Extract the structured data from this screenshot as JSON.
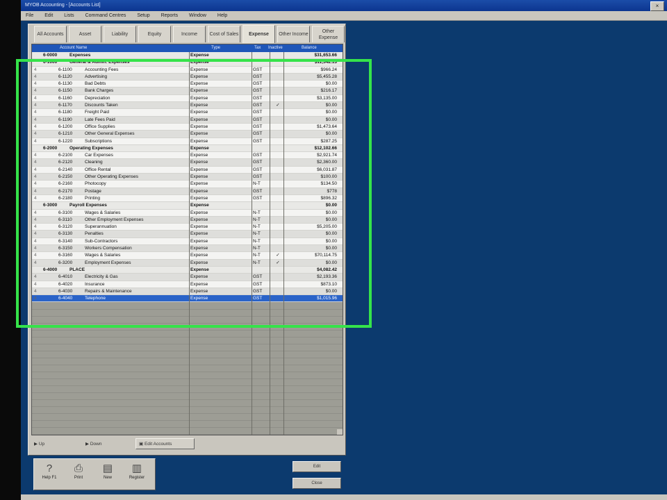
{
  "window": {
    "title": "MYOB Accounting - [Accounts List]",
    "close_label": "×"
  },
  "menu": [
    "File",
    "Edit",
    "Lists",
    "Command Centres",
    "Setup",
    "Reports",
    "Window",
    "Help"
  ],
  "tabs": [
    {
      "label": "All Accounts",
      "active": false
    },
    {
      "label": "Asset",
      "active": false
    },
    {
      "label": "Liability",
      "active": false
    },
    {
      "label": "Equity",
      "active": false
    },
    {
      "label": "Income",
      "active": false
    },
    {
      "label": "Cost of Sales",
      "active": false
    },
    {
      "label": "Expense",
      "active": true
    },
    {
      "label": "Other Income",
      "active": false
    },
    {
      "label": "Other Expense",
      "active": false
    }
  ],
  "columns": {
    "name": "Account Name",
    "type": "Type",
    "tax": "Tax",
    "inactive": "Inactive",
    "balance": "Balance"
  },
  "rows": [
    {
      "lvl": "",
      "code": "6-0000",
      "name": "Expenses",
      "type": "Expense",
      "tax": "",
      "inactive": "",
      "balance": "$31,653.66",
      "header": true
    },
    {
      "lvl": "",
      "code": "6-1000",
      "name": "General & Admin. Expenses",
      "type": "Expense",
      "tax": "",
      "inactive": "",
      "balance": "$11,342.13",
      "header": true
    },
    {
      "lvl": "4",
      "code": "6-1100",
      "name": "Accounting Fees",
      "type": "Expense",
      "tax": "GST",
      "inactive": "",
      "balance": "$966.24"
    },
    {
      "lvl": "4",
      "code": "6-1120",
      "name": "Advertising",
      "type": "Expense",
      "tax": "GST",
      "inactive": "",
      "balance": "$5,455.28"
    },
    {
      "lvl": "4",
      "code": "6-1130",
      "name": "Bad Debts",
      "type": "Expense",
      "tax": "GST",
      "inactive": "",
      "balance": "$0.00"
    },
    {
      "lvl": "4",
      "code": "6-1150",
      "name": "Bank Charges",
      "type": "Expense",
      "tax": "GST",
      "inactive": "",
      "balance": "$216.17"
    },
    {
      "lvl": "4",
      "code": "6-1160",
      "name": "Depreciation",
      "type": "Expense",
      "tax": "GST",
      "inactive": "",
      "balance": "$3,135.00"
    },
    {
      "lvl": "4",
      "code": "6-1170",
      "name": "Discounts Taken",
      "type": "Expense",
      "tax": "GST",
      "inactive": "✓",
      "balance": "$0.00"
    },
    {
      "lvl": "4",
      "code": "6-1180",
      "name": "Freight Paid",
      "type": "Expense",
      "tax": "GST",
      "inactive": "",
      "balance": "$0.00"
    },
    {
      "lvl": "4",
      "code": "6-1190",
      "name": "Late Fees Paid",
      "type": "Expense",
      "tax": "GST",
      "inactive": "",
      "balance": "$0.00"
    },
    {
      "lvl": "4",
      "code": "6-1200",
      "name": "Office Supplies",
      "type": "Expense",
      "tax": "GST",
      "inactive": "",
      "balance": "$1,473.64"
    },
    {
      "lvl": "4",
      "code": "6-1210",
      "name": "Other General Expenses",
      "type": "Expense",
      "tax": "GST",
      "inactive": "",
      "balance": "$0.00"
    },
    {
      "lvl": "4",
      "code": "6-1220",
      "name": "Subscriptions",
      "type": "Expense",
      "tax": "GST",
      "inactive": "",
      "balance": "$287.25"
    },
    {
      "lvl": "",
      "code": "6-2000",
      "name": "Operating Expenses",
      "type": "Expense",
      "tax": "",
      "inactive": "",
      "balance": "$12,102.66",
      "header": true
    },
    {
      "lvl": "4",
      "code": "6-2100",
      "name": "Car Expenses",
      "type": "Expense",
      "tax": "GST",
      "inactive": "",
      "balance": "$2,921.74"
    },
    {
      "lvl": "4",
      "code": "6-2120",
      "name": "Cleaning",
      "type": "Expense",
      "tax": "GST",
      "inactive": "",
      "balance": "$2,360.00"
    },
    {
      "lvl": "4",
      "code": "6-2140",
      "name": "Office Rental",
      "type": "Expense",
      "tax": "GST",
      "inactive": "",
      "balance": "$6,031.87"
    },
    {
      "lvl": "4",
      "code": "6-2150",
      "name": "Other Operating Expenses",
      "type": "Expense",
      "tax": "GST",
      "inactive": "",
      "balance": "$100.00"
    },
    {
      "lvl": "4",
      "code": "6-2160",
      "name": "Photocopy",
      "type": "Expense",
      "tax": "N-T",
      "inactive": "",
      "balance": "$134.50"
    },
    {
      "lvl": "4",
      "code": "6-2170",
      "name": "Postage",
      "type": "Expense",
      "tax": "GST",
      "inactive": "",
      "balance": "$778"
    },
    {
      "lvl": "4",
      "code": "6-2180",
      "name": "Printing",
      "type": "Expense",
      "tax": "GST",
      "inactive": "",
      "balance": "$896.32"
    },
    {
      "lvl": "",
      "code": "6-3000",
      "name": "Payroll Expenses",
      "type": "Expense",
      "tax": "",
      "inactive": "",
      "balance": "$0.00",
      "header": true
    },
    {
      "lvl": "4",
      "code": "6-3100",
      "name": "Wages & Salaries",
      "type": "Expense",
      "tax": "N-T",
      "inactive": "",
      "balance": "$0.00"
    },
    {
      "lvl": "4",
      "code": "6-3110",
      "name": "Other Employment Expenses",
      "type": "Expense",
      "tax": "N-T",
      "inactive": "",
      "balance": "$0.00"
    },
    {
      "lvl": "4",
      "code": "6-3120",
      "name": "Superannuation",
      "type": "Expense",
      "tax": "N-T",
      "inactive": "",
      "balance": "$5,205.00"
    },
    {
      "lvl": "4",
      "code": "6-3130",
      "name": "Penalties",
      "type": "Expense",
      "tax": "N-T",
      "inactive": "",
      "balance": "$0.00"
    },
    {
      "lvl": "4",
      "code": "6-3140",
      "name": "Sub-Contractors",
      "type": "Expense",
      "tax": "N-T",
      "inactive": "",
      "balance": "$0.00"
    },
    {
      "lvl": "4",
      "code": "6-3150",
      "name": "Workers Compensation",
      "type": "Expense",
      "tax": "N-T",
      "inactive": "",
      "balance": "$0.00"
    },
    {
      "lvl": "4",
      "code": "6-3160",
      "name": "Wages & Salaries",
      "type": "Expense",
      "tax": "N-T",
      "inactive": "✓",
      "balance": "$70,114.75"
    },
    {
      "lvl": "4",
      "code": "6-3200",
      "name": "Employment Expenses",
      "type": "Expense",
      "tax": "N-T",
      "inactive": "✓",
      "balance": "$0.00"
    },
    {
      "lvl": "",
      "code": "6-4000",
      "name": "PLACE",
      "type": "Expense",
      "tax": "",
      "inactive": "",
      "balance": "$4,082.42",
      "header": true
    },
    {
      "lvl": "4",
      "code": "6-4010",
      "name": "Electricity & Gas",
      "type": "Expense",
      "tax": "GST",
      "inactive": "",
      "balance": "$2,193.36"
    },
    {
      "lvl": "4",
      "code": "6-4020",
      "name": "Insurance",
      "type": "Expense",
      "tax": "GST",
      "inactive": "",
      "balance": "$873.10"
    },
    {
      "lvl": "4",
      "code": "6-4030",
      "name": "Repairs & Maintenance",
      "type": "Expense",
      "tax": "GST",
      "inactive": "",
      "balance": "$0.00"
    },
    {
      "lvl": "4",
      "code": "6-4040",
      "name": "Telephone",
      "type": "Expense",
      "tax": "GST",
      "inactive": "",
      "balance": "$1,015.96",
      "selected": true
    }
  ],
  "bottom_bar": {
    "radio_up": "Up",
    "radio_down": "Down",
    "group_button": "Edit Accounts"
  },
  "toolbar": [
    {
      "label": "Help F1",
      "icon": "help-icon"
    },
    {
      "label": "Print",
      "icon": "print-icon"
    },
    {
      "label": "New",
      "icon": "new-icon"
    },
    {
      "label": "Register",
      "icon": "register-icon"
    }
  ],
  "side_buttons": [
    "Edit",
    "Close"
  ],
  "colors": {
    "desktop": "#0c3a6e",
    "header": "#1f56b8",
    "selected_row": "#2a63c8",
    "highlight": "#35e34a"
  }
}
